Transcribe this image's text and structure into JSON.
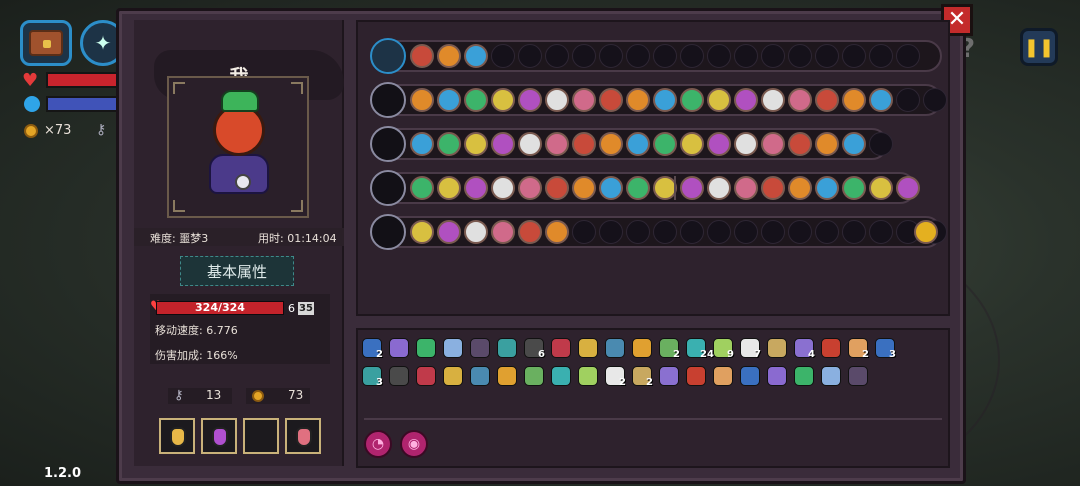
{
  "hud": {
    "coin_text": "×73",
    "version": "1.2.0",
    "pause_icon": "pause-icon",
    "close_icon": "close-icon"
  },
  "character": {
    "name": "我",
    "difficulty": "难度: 噩梦3",
    "time": "用时: 01:14:04",
    "attr_title": "基本属性",
    "hp_text": "324/324",
    "hp_extra": "6",
    "shield": "35",
    "move_speed": "移动速度: 6.776",
    "damage_bonus": "伤害加成: 166%",
    "keys": "13",
    "coins": "73"
  },
  "potions": [
    {
      "icon": "yellow-potion-icon",
      "color": "#e8b848"
    },
    {
      "icon": "purple-potion-icon",
      "color": "#b050d0"
    },
    {
      "icon": "empty-slot",
      "color": ""
    },
    {
      "icon": "red-potion-icon",
      "color": "#e07080"
    }
  ],
  "weapon_rows": [
    {
      "weapon": "chest-icon",
      "slots": 24
    },
    {
      "weapon": "staff-spiked-icon",
      "slots": 20
    },
    {
      "weapon": "green-branch-staff-icon",
      "slots": 18
    },
    {
      "weapon": "dark-orb-staff-icon",
      "slots": 19
    },
    {
      "weapon": "star-wand-icon",
      "slots": 20
    }
  ],
  "inventory": {
    "counts": [
      "2",
      "6",
      "2",
      "24",
      "9",
      "7",
      "4",
      "2",
      "3",
      "3",
      "2",
      "2"
    ]
  }
}
